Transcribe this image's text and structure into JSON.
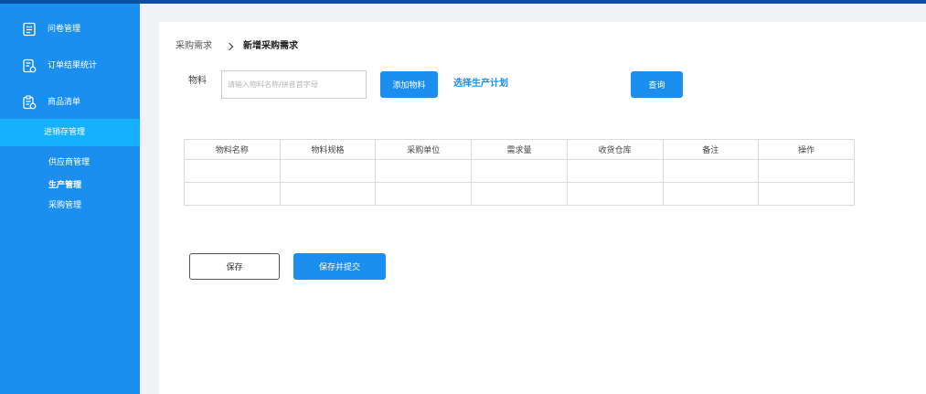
{
  "sidebar": {
    "items": [
      {
        "label": "问卷管理",
        "icon": "document-icon"
      },
      {
        "label": "订单结果统计",
        "icon": "order-stats-icon"
      },
      {
        "label": "商品清单",
        "icon": "product-list-icon"
      }
    ],
    "active_group": "进销存管理",
    "subitems": [
      "供应商管理",
      "生产管理",
      "采购管理"
    ]
  },
  "breadcrumb": {
    "parent": "采购需求",
    "current": "新增采购需求"
  },
  "search": {
    "label": "物料",
    "placeholder": "请输入物料名称/拼音首字母",
    "value": ""
  },
  "toolbar": {
    "add_material": "添加物料",
    "select_plan": "选择生产计划",
    "query": "查询"
  },
  "table": {
    "columns": [
      "物料名称",
      "物料规格",
      "采购单位",
      "需求量",
      "收货仓库",
      "备注",
      "操作"
    ],
    "rows": [
      [
        "",
        "",
        "",
        "",
        "",
        "",
        ""
      ],
      [
        "",
        "",
        "",
        "",
        "",
        "",
        ""
      ]
    ]
  },
  "actions": {
    "save": "保存",
    "save_submit": "保存并提交"
  },
  "colors": {
    "sidebar": "#1a8ff0",
    "sidebar_active": "#15b1ff",
    "topbar": "#0b4fa0",
    "primary": "#1a8ff0"
  }
}
